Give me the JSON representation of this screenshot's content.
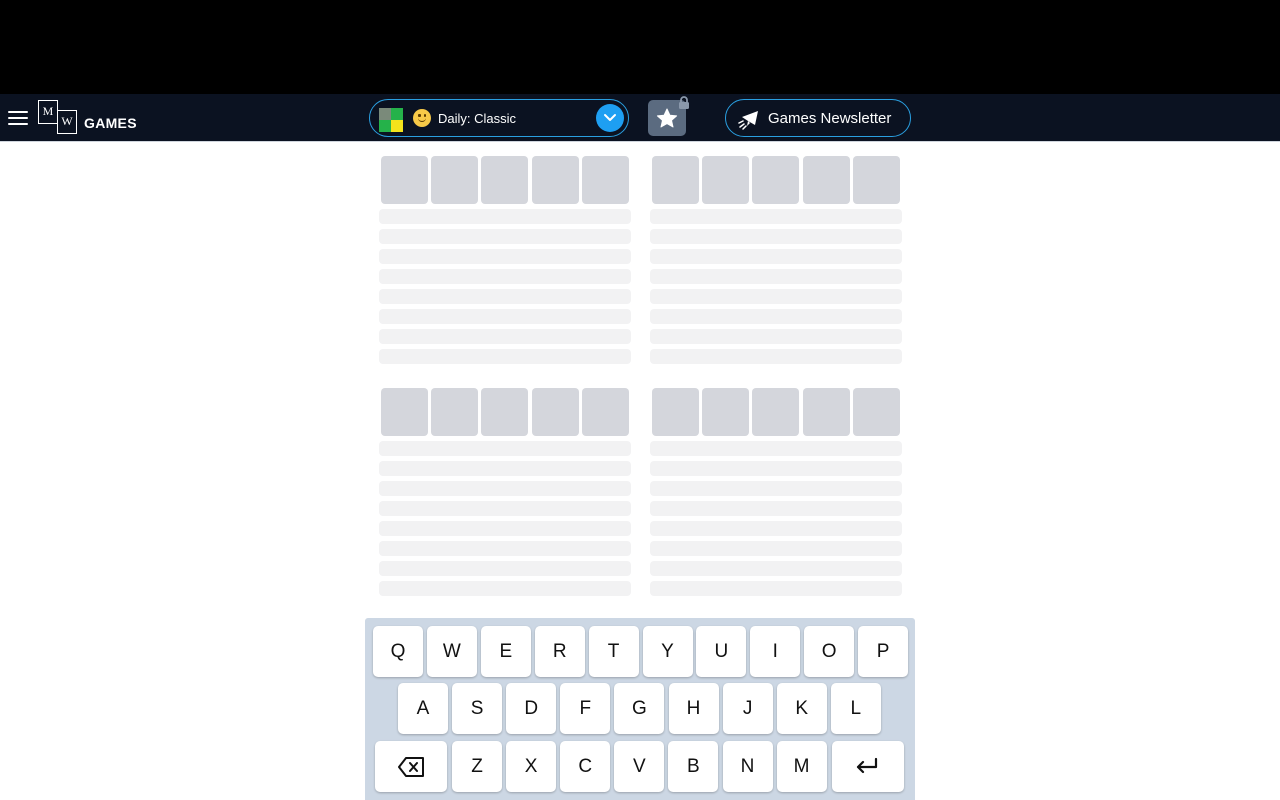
{
  "navbar": {
    "logo": {
      "tile_m": "M",
      "tile_w": "W",
      "word": "GAMES"
    },
    "game_select": {
      "label": "Daily: Classic",
      "thumb_colors": [
        "#7a8a7a",
        "#25b24a",
        "#25b24a",
        "#f4e31c"
      ]
    },
    "newsletter_label": "Games Newsletter"
  },
  "boards": {
    "count": 4,
    "cells_per_row": 5,
    "placeholder_lines": 8
  },
  "keyboard": {
    "row1": [
      "Q",
      "W",
      "E",
      "R",
      "T",
      "Y",
      "U",
      "I",
      "O",
      "P"
    ],
    "row2": [
      "A",
      "S",
      "D",
      "F",
      "G",
      "H",
      "J",
      "K",
      "L"
    ],
    "row3": [
      "Z",
      "X",
      "C",
      "V",
      "B",
      "N",
      "M"
    ],
    "backspace_icon": "backspace-icon",
    "enter_icon": "enter-icon"
  },
  "colors": {
    "navbar_bg": "#0b1221",
    "accent_blue": "#1e9ff2",
    "tile_gray": "#d4d6dc",
    "line_gray": "#f2f2f3",
    "keyboard_bg": "#ccd7e4"
  }
}
